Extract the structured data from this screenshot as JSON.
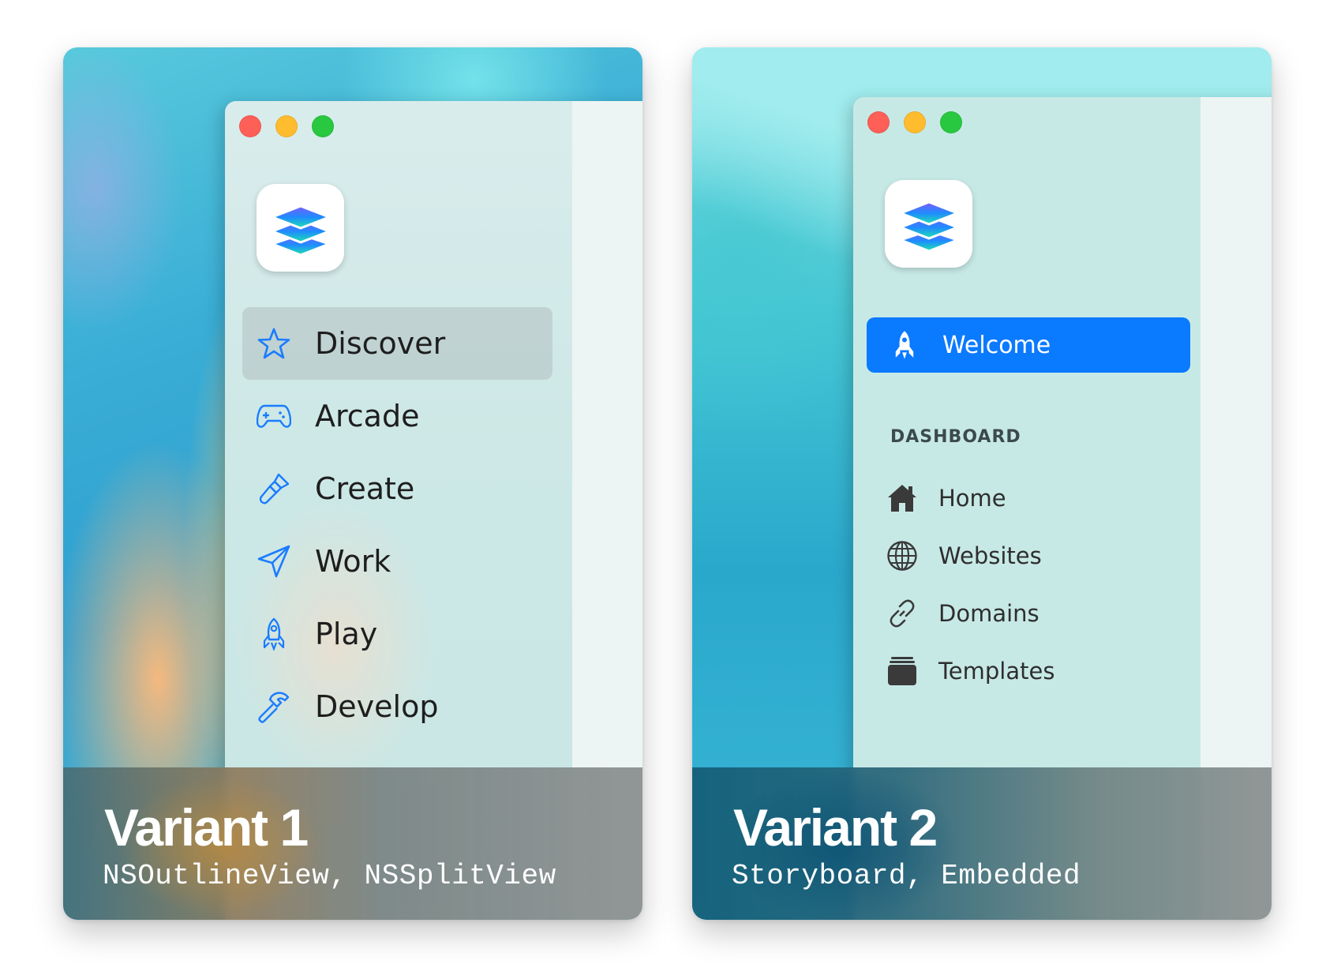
{
  "variants": [
    {
      "title": "Variant 1",
      "subtitle": "NSOutlineView, NSSplitView",
      "sidebar": {
        "items": [
          {
            "label": "Discover",
            "icon": "star-icon",
            "selected": true
          },
          {
            "label": "Arcade",
            "icon": "gamecontroller-icon"
          },
          {
            "label": "Create",
            "icon": "paintbrush-icon"
          },
          {
            "label": "Work",
            "icon": "paperplane-icon"
          },
          {
            "label": "Play",
            "icon": "rocket-icon"
          },
          {
            "label": "Develop",
            "icon": "hammer-icon"
          }
        ]
      }
    },
    {
      "title": "Variant 2",
      "subtitle": "Storyboard, Embedded",
      "sidebar": {
        "welcome": {
          "label": "Welcome",
          "icon": "rocket-icon",
          "selected": true
        },
        "section_title": "DASHBOARD",
        "items": [
          {
            "label": "Home",
            "icon": "house-icon"
          },
          {
            "label": "Websites",
            "icon": "globe-icon"
          },
          {
            "label": "Domains",
            "icon": "link-icon"
          },
          {
            "label": "Templates",
            "icon": "tray-stack-icon"
          }
        ]
      }
    }
  ],
  "colors": {
    "accent": "#0a7aff",
    "sidebar_icon_blue": "#1a7cff",
    "traffic_red": "#fe5f57",
    "traffic_yellow": "#febc2e",
    "traffic_green": "#28c840"
  },
  "app_icon": "layers-stack-icon"
}
